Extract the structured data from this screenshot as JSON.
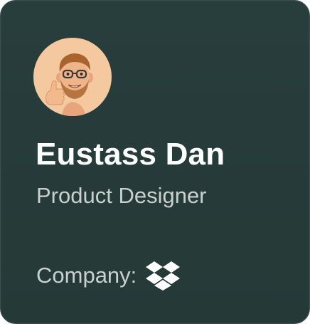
{
  "profile": {
    "name": "Eustass Dan",
    "title": "Product Designer",
    "company_label": "Company:",
    "avatar_icon": "memoji-thumbs-up-avatar",
    "company_icon": "dropbox-logo-icon"
  },
  "colors": {
    "card_background": "#273b39",
    "name_text": "#ffffff",
    "secondary_text": "#c9d0cf",
    "avatar_background": "#f4c9a0"
  }
}
